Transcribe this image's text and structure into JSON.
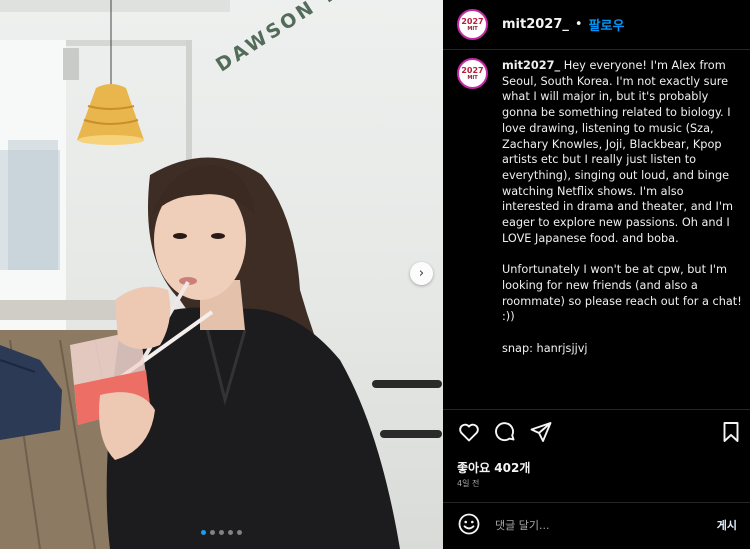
{
  "post": {
    "username": "mit2027_",
    "separator": "•",
    "follow_label": "팔로우",
    "avatar_year": "2027",
    "avatar_org": "MIT",
    "wall_sign": "DAWSON TREATY ABOUT",
    "caption_username": "mit2027_",
    "caption_text": " Hey everyone! I'm Alex from Seoul, South Korea. I'm not exactly sure what I will major in, but it's probably gonna be something related to biology. I love drawing, listening to music (Sza, Zachary Knowles, Joji, Blackbear, Kpop artists etc but I really just listen to everything), singing out loud, and binge watching Netflix shows. I'm also interested in drama and theater, and I'm eager to explore new passions. Oh and I LOVE Japanese food. and boba.\n\nUnfortunately I won't be at cpw, but I'm looking for new friends (and also a roommate) so please reach out for a chat! :))\n\nsnap: hanrjsjjvj",
    "likes": "좋아요 402개",
    "time_ago": "4일 전",
    "comment_placeholder": "댓글 달기...",
    "post_button": "게시",
    "carousel": {
      "count": 5,
      "active": 0
    }
  },
  "icons": {
    "like": "heart-icon",
    "comment": "comment-icon",
    "share": "paper-plane-icon",
    "save": "bookmark-icon",
    "emoji": "smiley-icon",
    "next": "chevron-right-icon"
  },
  "colors": {
    "background": "#000000",
    "follow": "#0095f6",
    "divider": "#262626",
    "muted": "#a8a8a8",
    "carousel_active": "#1d9bf0"
  }
}
